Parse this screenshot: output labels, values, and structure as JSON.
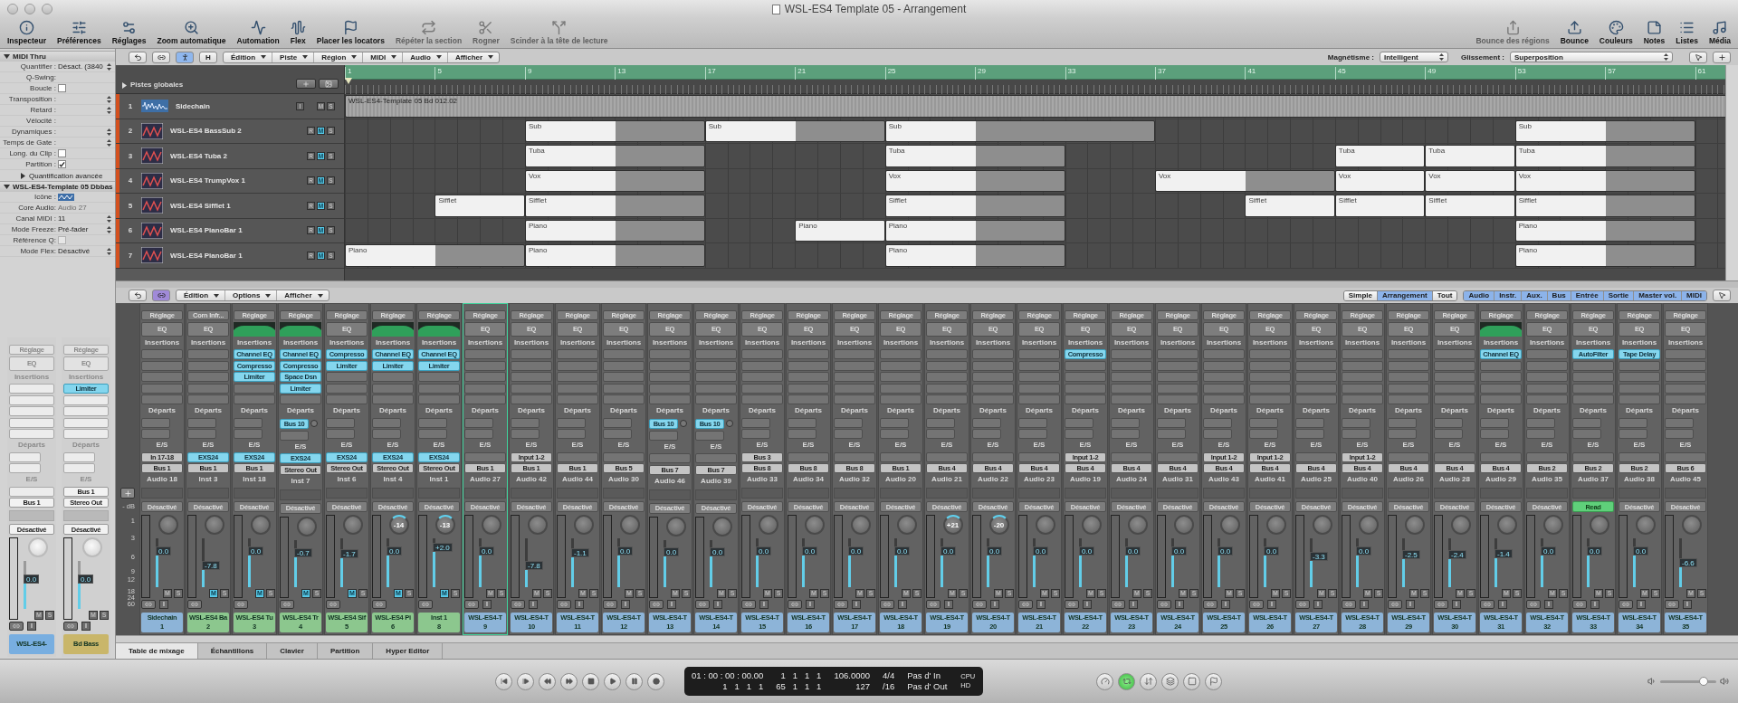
{
  "window": {
    "title": "WSL-ES4 Template 05 - Arrangement"
  },
  "toolbar": {
    "left": [
      {
        "label": "Inspecteur",
        "disabled": false
      },
      {
        "label": "Préférences",
        "disabled": false
      },
      {
        "label": "Réglages",
        "disabled": false
      },
      {
        "label": "Zoom automatique",
        "disabled": false
      },
      {
        "label": "Automation",
        "disabled": false
      },
      {
        "label": "Flex",
        "disabled": false
      },
      {
        "label": "Placer les locators",
        "disabled": false
      },
      {
        "label": "Répéter la section",
        "disabled": true
      },
      {
        "label": "Rogner",
        "disabled": true
      },
      {
        "label": "Scinder à la tête de lecture",
        "disabled": true
      }
    ],
    "right": [
      {
        "label": "Bounce des régions",
        "disabled": true
      },
      {
        "label": "Bounce",
        "disabled": false
      },
      {
        "label": "Couleurs",
        "disabled": false
      },
      {
        "label": "Notes",
        "disabled": false
      },
      {
        "label": "Listes",
        "disabled": false
      },
      {
        "label": "Média",
        "disabled": false
      }
    ]
  },
  "arrange_toolbar": {
    "tools": [
      {
        "kind": "back",
        "on": false
      },
      {
        "kind": "link",
        "on": false
      },
      {
        "kind": "catch",
        "on": true
      },
      {
        "kind": "text",
        "label": "H",
        "on": false
      }
    ],
    "menus": [
      "Édition",
      "Piste",
      "Région",
      "MIDI",
      "Audio",
      "Afficher"
    ],
    "magnetism_label": "Magnétisme :",
    "magnetism": "Intelligent",
    "drag_label": "Glissement :",
    "drag": "Superposition"
  },
  "inspector": {
    "region_header": {
      "label": "MIDI Thru",
      "expanded": true
    },
    "region_params": [
      {
        "label": "Quantifier :",
        "value": "Désact. (3840",
        "kind": "select"
      },
      {
        "label": "Q-Swing:",
        "kind": "text"
      },
      {
        "label": "Boucle :",
        "kind": "checkbox",
        "checked": false
      },
      {
        "label": "Transposition :",
        "kind": "select"
      },
      {
        "label": "Retard :",
        "kind": "select"
      },
      {
        "label": "Vélocité :",
        "kind": "text"
      },
      {
        "label": "Dynamiques :",
        "kind": "select"
      },
      {
        "label": "Temps de Gate :",
        "kind": "select"
      },
      {
        "label": "Long. du Clip :",
        "kind": "checkbox",
        "checked": false
      },
      {
        "label": "Partition :",
        "kind": "checkbox",
        "checked": true
      }
    ],
    "advanced": {
      "label": "Quantification avancée",
      "expanded": false
    },
    "track_header": {
      "label": "WSL-ES4-Template 05 Dbbas",
      "expanded": true
    },
    "track_params": [
      {
        "label": "Icône :",
        "kind": "icon"
      },
      {
        "label": "Core Audio:",
        "value": "Audio 27",
        "kind": "text",
        "disabled": true
      },
      {
        "label": "Canal MIDI :",
        "value": "11",
        "kind": "select"
      },
      {
        "label": "Mode Freeze:",
        "value": "Pré-fader",
        "kind": "select"
      },
      {
        "label": "Référence Q:",
        "kind": "checkbox",
        "checked": false,
        "disabled": true
      },
      {
        "label": "Mode Flex:",
        "value": "Désactivé",
        "kind": "select"
      }
    ],
    "strips": [
      {
        "setting": "Réglage",
        "eq": "EQ",
        "inserts_label": "Insertions",
        "sends_label": "Départs",
        "io_label": "E/S",
        "output": "Bus 1",
        "automation": "Désactivé",
        "read": false,
        "fader": "0.0",
        "level": 0.62,
        "mute": {
          "label": "M",
          "on": false
        },
        "solo": {
          "label": "S",
          "on": false
        },
        "monitor": "I",
        "name": "WSL-ES4-",
        "color": "#78aee0",
        "selected": false
      },
      {
        "setting": "Réglage",
        "eq": "EQ",
        "inserts_label": "Insertions",
        "inserts": [
          "Limiter"
        ],
        "sends_label": "Départs",
        "io_label": "E/S",
        "input": "Bus 1",
        "output": "Stereo Out",
        "automation": "Désactivé",
        "read": false,
        "fader": "0.0",
        "level": 0.62,
        "mute": {
          "label": "M",
          "on": false
        },
        "solo": {
          "label": "S",
          "on": false
        },
        "monitor": "I",
        "name": "Bd Bass",
        "color": "#c9b66a",
        "selected": false
      }
    ]
  },
  "global_tracks": {
    "label": "Pistes globales",
    "expanded": false
  },
  "ruler": [
    "1",
    "5",
    "9",
    "13",
    "17",
    "21",
    "25",
    "29",
    "33",
    "37",
    "41",
    "45",
    "49",
    "53",
    "57",
    "61"
  ],
  "tracks": [
    {
      "number": "1",
      "name": "Sidechain",
      "kind": "audio",
      "buttons": [
        {
          "label": "I",
          "on": false
        },
        {
          "label": "M",
          "on": false
        },
        {
          "label": "S",
          "on": false
        }
      ],
      "lane": [
        {
          "kind": "region",
          "label": "WSL-ES4-Template 05 Bd 012.02"
        },
        {
          "kind": "more"
        },
        {
          "kind": "more"
        },
        {
          "kind": "more"
        },
        {
          "kind": "more"
        },
        {
          "kind": "more"
        },
        {
          "kind": "more"
        },
        {
          "kind": "more"
        },
        {
          "kind": "more"
        },
        {
          "kind": "more"
        },
        {
          "kind": "more"
        },
        {
          "kind": "more"
        },
        {
          "kind": "more"
        },
        {
          "kind": "more"
        },
        {
          "kind": "more"
        },
        {
          "kind": "more"
        }
      ]
    },
    {
      "number": "2",
      "name": "WSL-ES4 BassSub 2",
      "kind": "instrument",
      "buttons": [
        {
          "label": "R",
          "on": false
        },
        {
          "label": "M",
          "on": true
        },
        {
          "label": "S",
          "on": false
        }
      ],
      "lane": [
        {
          "kind": "gap"
        },
        {
          "kind": "gap"
        },
        {
          "kind": "region",
          "label": "Sub"
        },
        {
          "kind": "more"
        },
        {
          "kind": "region",
          "label": "Sub"
        },
        {
          "kind": "more"
        },
        {
          "kind": "region",
          "label": "Sub"
        },
        {
          "kind": "more"
        },
        {
          "kind": "more"
        },
        {
          "kind": "gap"
        },
        {
          "kind": "gap"
        },
        {
          "kind": "gap"
        },
        {
          "kind": "gap"
        },
        {
          "kind": "region",
          "label": "Sub"
        },
        {
          "kind": "more"
        }
      ]
    },
    {
      "number": "3",
      "name": "WSL-ES4 Tuba 2",
      "kind": "instrument",
      "buttons": [
        {
          "label": "R",
          "on": false
        },
        {
          "label": "M",
          "on": true
        },
        {
          "label": "S",
          "on": false
        }
      ],
      "lane": [
        {
          "kind": "gap"
        },
        {
          "kind": "gap"
        },
        {
          "kind": "region",
          "label": "Tuba"
        },
        {
          "kind": "more"
        },
        {
          "kind": "gap"
        },
        {
          "kind": "gap"
        },
        {
          "kind": "region",
          "label": "Tuba"
        },
        {
          "kind": "more"
        },
        {
          "kind": "gap"
        },
        {
          "kind": "gap"
        },
        {
          "kind": "gap"
        },
        {
          "kind": "region",
          "label": "Tuba"
        },
        {
          "kind": "region",
          "label": "Tuba"
        },
        {
          "kind": "region",
          "label": "Tuba"
        },
        {
          "kind": "more"
        }
      ]
    },
    {
      "number": "4",
      "name": "WSL-ES4 TrumpVox 1",
      "kind": "instrument",
      "buttons": [
        {
          "label": "R",
          "on": false
        },
        {
          "label": "M",
          "on": true
        },
        {
          "label": "S",
          "on": false
        }
      ],
      "lane": [
        {
          "kind": "gap"
        },
        {
          "kind": "gap"
        },
        {
          "kind": "region",
          "label": "Vox"
        },
        {
          "kind": "more"
        },
        {
          "kind": "gap"
        },
        {
          "kind": "gap"
        },
        {
          "kind": "region",
          "label": "Vox"
        },
        {
          "kind": "more"
        },
        {
          "kind": "gap"
        },
        {
          "kind": "region",
          "label": "Vox"
        },
        {
          "kind": "more"
        },
        {
          "kind": "region",
          "label": "Vox"
        },
        {
          "kind": "region",
          "label": "Vox"
        },
        {
          "kind": "region",
          "label": "Vox"
        },
        {
          "kind": "more"
        }
      ]
    },
    {
      "number": "5",
      "name": "WSL-ES4 Sifflet 1",
      "kind": "instrument",
      "buttons": [
        {
          "label": "R",
          "on": false
        },
        {
          "label": "M",
          "on": true
        },
        {
          "label": "S",
          "on": false
        }
      ],
      "lane": [
        {
          "kind": "gap"
        },
        {
          "kind": "region",
          "label": "Sifflet"
        },
        {
          "kind": "region",
          "label": "Sifflet"
        },
        {
          "kind": "more"
        },
        {
          "kind": "gap"
        },
        {
          "kind": "gap"
        },
        {
          "kind": "region",
          "label": "Sifflet"
        },
        {
          "kind": "more"
        },
        {
          "kind": "gap"
        },
        {
          "kind": "gap"
        },
        {
          "kind": "region",
          "label": "Sifflet"
        },
        {
          "kind": "region",
          "label": "Sifflet"
        },
        {
          "kind": "region",
          "label": "Sifflet"
        },
        {
          "kind": "region",
          "label": "Sifflet"
        },
        {
          "kind": "more"
        }
      ]
    },
    {
      "number": "6",
      "name": "WSL-ES4 PianoBar 1",
      "kind": "instrument",
      "buttons": [
        {
          "label": "R",
          "on": false
        },
        {
          "label": "M",
          "on": true
        },
        {
          "label": "S",
          "on": false
        }
      ],
      "lane": [
        {
          "kind": "gap"
        },
        {
          "kind": "gap"
        },
        {
          "kind": "region",
          "label": "Piano"
        },
        {
          "kind": "more"
        },
        {
          "kind": "gap"
        },
        {
          "kind": "region",
          "label": "Piano"
        },
        {
          "kind": "region",
          "label": "Piano"
        },
        {
          "kind": "more"
        },
        {
          "kind": "gap"
        },
        {
          "kind": "gap"
        },
        {
          "kind": "gap"
        },
        {
          "kind": "gap"
        },
        {
          "kind": "gap"
        },
        {
          "kind": "region",
          "label": "Piano"
        },
        {
          "kind": "more"
        }
      ]
    },
    {
      "number": "7",
      "name": "WSL-ES4 PianoBar 1",
      "kind": "instrument",
      "buttons": [
        {
          "label": "R",
          "on": false
        },
        {
          "label": "M",
          "on": true
        },
        {
          "label": "S",
          "on": false
        }
      ],
      "lane": [
        {
          "kind": "region",
          "label": "Piano"
        },
        {
          "kind": "more"
        },
        {
          "kind": "region",
          "label": "Piano"
        },
        {
          "kind": "more"
        },
        {
          "kind": "gap"
        },
        {
          "kind": "gap"
        },
        {
          "kind": "region",
          "label": "Piano"
        },
        {
          "kind": "more"
        },
        {
          "kind": "gap"
        },
        {
          "kind": "gap"
        },
        {
          "kind": "gap"
        },
        {
          "kind": "gap"
        },
        {
          "kind": "gap"
        },
        {
          "kind": "region",
          "label": "Piano"
        },
        {
          "kind": "more"
        }
      ]
    }
  ],
  "mixer_toolbar": {
    "tools": [
      {
        "kind": "back",
        "on": false
      },
      {
        "kind": "link",
        "on": true
      }
    ],
    "menus": [
      "Édition",
      "Options",
      "Afficher"
    ],
    "views": [
      {
        "label": "Simple",
        "selected": false
      },
      {
        "label": "Arrangement",
        "selected": true
      },
      {
        "label": "Tout",
        "selected": false
      }
    ],
    "filters": [
      {
        "label": "Audio",
        "selected": true
      },
      {
        "label": "Instr.",
        "selected": true
      },
      {
        "label": "Aux.",
        "selected": true
      },
      {
        "label": "Bus",
        "selected": true
      },
      {
        "label": "Entrée",
        "selected": true
      },
      {
        "label": "Sortie",
        "selected": true
      },
      {
        "label": "Master vol.",
        "selected": true
      },
      {
        "label": "MIDI",
        "selected": true
      }
    ]
  },
  "db_scale": [
    "- dB",
    "1",
    "3",
    "6",
    "9",
    "12",
    "18",
    "24",
    "60"
  ],
  "strips": [
    {
      "setting": "Réglage",
      "eq": "EQ",
      "inserts_label": "Insertions",
      "sends_label": "Départs",
      "io_label": "E/S",
      "input": "In 17-18",
      "output": "Bus 1",
      "track": "Audio 18",
      "automation": "Désactivé",
      "read": false,
      "fader": "0.0",
      "level": 0.75,
      "mute": {
        "label": "M",
        "on": false
      },
      "solo": {
        "label": "S",
        "on": false
      },
      "monitor": "I",
      "name": "Sidechain",
      "number": "1",
      "color": "#8db4d8",
      "selected": false
    },
    {
      "setting": "Corn Infr...",
      "eq": "EQ",
      "inserts_label": "Insertions",
      "sends_label": "Départs",
      "io_label": "E/S",
      "input": "EXS24",
      "input_plugin": true,
      "output": "Bus 1",
      "track": "Inst 3",
      "automation": "Désactivé",
      "read": false,
      "fader": "-7.8",
      "level": 0.45,
      "mute": {
        "label": "M",
        "on": true
      },
      "solo": {
        "label": "S",
        "on": false
      },
      "name": "WSL-ES4 Ba",
      "number": "2",
      "color": "#8cc78e",
      "selected": false
    },
    {
      "setting": "Réglage",
      "eq_curve": true,
      "inserts_label": "Insertions",
      "inserts": [
        "Channel EQ",
        "Compresso",
        "Limiter"
      ],
      "sends_label": "Départs",
      "io_label": "E/S",
      "input": "EXS24",
      "input_plugin": true,
      "output": "Bus 1",
      "track": "Inst 18",
      "automation": "Désactivé",
      "read": false,
      "fader": "0.0",
      "level": 0.75,
      "mute": {
        "label": "M",
        "on": true
      },
      "solo": {
        "label": "S",
        "on": false
      },
      "name": "WSL-ES4 Tu",
      "number": "3",
      "color": "#8cc78e",
      "selected": false
    },
    {
      "setting": "Réglage",
      "eq_curve": true,
      "inserts_label": "Insertions",
      "inserts": [
        "Channel EQ",
        "Compresso",
        "Space Dsn",
        "Limiter"
      ],
      "sends_label": "Départs",
      "sends": [
        "Bus 10"
      ],
      "io_label": "E/S",
      "input": "EXS24",
      "input_plugin": true,
      "output": "Stereo Out",
      "track": "Inst 7",
      "automation": "Désactivé",
      "read": false,
      "fader": "-0.7",
      "level": 0.72,
      "mute": {
        "label": "M",
        "on": true
      },
      "solo": {
        "label": "S",
        "on": false
      },
      "name": "WSL-ES4 Tr",
      "number": "4",
      "color": "#8cc78e",
      "selected": false
    },
    {
      "setting": "Réglage",
      "eq": "EQ",
      "inserts_label": "Insertions",
      "inserts": [
        "Compresso",
        "Limiter"
      ],
      "sends_label": "Départs",
      "io_label": "E/S",
      "input": "EXS24",
      "input_plugin": true,
      "output": "Stereo Out",
      "track": "Inst 6",
      "automation": "Désactivé",
      "read": false,
      "fader": "-1.7",
      "level": 0.68,
      "mute": {
        "label": "M",
        "on": true
      },
      "solo": {
        "label": "S",
        "on": false
      },
      "name": "WSL-ES4 Sif",
      "number": "5",
      "color": "#8cc78e",
      "selected": false
    },
    {
      "setting": "Réglage",
      "eq_curve": true,
      "inserts_label": "Insertions",
      "inserts": [
        "Channel EQ",
        "Limiter"
      ],
      "sends_label": "Départs",
      "io_label": "E/S",
      "input": "EXS24",
      "input_plugin": true,
      "output": "Stereo Out",
      "track": "Inst 4",
      "automation": "Désactivé",
      "read": false,
      "pan": "-14",
      "fader": "0.0",
      "level": 0.75,
      "mute": {
        "label": "M",
        "on": true
      },
      "solo": {
        "label": "S",
        "on": false
      },
      "name": "WSL-ES4 Pi",
      "number": "6",
      "color": "#8cc78e",
      "selected": false
    },
    {
      "setting": "Réglage",
      "eq_curve": true,
      "inserts_label": "Insertions",
      "inserts": [
        "Channel EQ",
        "Limiter"
      ],
      "sends_label": "Départs",
      "io_label": "E/S",
      "input": "EXS24",
      "input_plugin": true,
      "output": "Stereo Out",
      "track": "Inst 1",
      "automation": "Désactivé",
      "read": false,
      "pan": "-13",
      "fader": "+2.0",
      "level": 0.82,
      "mute": {
        "label": "M",
        "on": true
      },
      "solo": {
        "label": "S",
        "on": false
      },
      "name": "Inst 1",
      "number": "8",
      "color": "#8cc78e",
      "selected": false
    },
    {
      "setting": "Réglage",
      "eq": "EQ",
      "inserts_label": "Insertions",
      "sends_label": "Départs",
      "io_label": "E/S",
      "output": "Bus 1",
      "track": "Audio 27",
      "automation": "Désactivé",
      "read": false,
      "fader": "0.0",
      "level": 0.75,
      "mute": {
        "label": "M",
        "on": false
      },
      "solo": {
        "label": "S",
        "on": false
      },
      "monitor": "I",
      "name": "WSL-ES4-T",
      "number": "9",
      "color": "#8db4d8",
      "selected": true
    },
    {
      "setting": "Réglage",
      "eq": "EQ",
      "inserts_label": "Insertions",
      "sends_label": "Départs",
      "io_label": "E/S",
      "input": "Input 1-2",
      "output": "Bus 1",
      "track": "Audio 42",
      "automation": "Désactivé",
      "read": false,
      "fader": "-7.8",
      "level": 0.45,
      "mute": {
        "label": "M",
        "on": false
      },
      "solo": {
        "label": "S",
        "on": false
      },
      "monitor": "I",
      "name": "WSL-ES4-T",
      "number": "10",
      "color": "#8db4d8",
      "selected": false
    },
    {
      "setting": "Réglage",
      "eq": "EQ",
      "inserts_label": "Insertions",
      "sends_label": "Départs",
      "io_label": "E/S",
      "output": "Bus 1",
      "track": "Audio 44",
      "automation": "Désactivé",
      "read": false,
      "fader": "-1.1",
      "level": 0.7,
      "mute": {
        "label": "M",
        "on": false
      },
      "solo": {
        "label": "S",
        "on": false
      },
      "monitor": "I",
      "name": "WSL-ES4-T",
      "number": "11",
      "color": "#8db4d8",
      "selected": false
    },
    {
      "setting": "Réglage",
      "eq": "EQ",
      "inserts_label": "Insertions",
      "sends_label": "Départs",
      "io_label": "E/S",
      "output": "Bus 5",
      "track": "Audio 30",
      "automation": "Désactivé",
      "read": false,
      "fader": "0.0",
      "level": 0.75,
      "mute": {
        "label": "M",
        "on": false
      },
      "solo": {
        "label": "S",
        "on": false
      },
      "monitor": "I",
      "name": "WSL-ES4-T",
      "number": "12",
      "color": "#8db4d8",
      "selected": false
    },
    {
      "setting": "Réglage",
      "eq": "EQ",
      "inserts_label": "Insertions",
      "sends_label": "Départs",
      "sends": [
        "Bus 10"
      ],
      "io_label": "E/S",
      "output": "Bus 7",
      "track": "Audio 46",
      "automation": "Désactivé",
      "read": false,
      "fader": "0.0",
      "level": 0.75,
      "mute": {
        "label": "M",
        "on": false
      },
      "solo": {
        "label": "S",
        "on": false
      },
      "monitor": "I",
      "name": "WSL-ES4-T",
      "number": "13",
      "color": "#8db4d8",
      "selected": false
    },
    {
      "setting": "Réglage",
      "eq": "EQ",
      "inserts_label": "Insertions",
      "sends_label": "Départs",
      "sends": [
        "Bus 10"
      ],
      "io_label": "E/S",
      "output": "Bus 7",
      "track": "Audio 39",
      "automation": "Désactivé",
      "read": false,
      "fader": "0.0",
      "level": 0.75,
      "mute": {
        "label": "M",
        "on": false
      },
      "solo": {
        "label": "S",
        "on": false
      },
      "monitor": "I",
      "name": "WSL-ES4-T",
      "number": "14",
      "color": "#8db4d8",
      "selected": false
    },
    {
      "setting": "Réglage",
      "eq": "EQ",
      "inserts_label": "Insertions",
      "sends_label": "Départs",
      "io_label": "E/S",
      "input": "Bus 3",
      "output": "Bus 8",
      "track": "Audio 33",
      "automation": "Désactivé",
      "read": false,
      "fader": "0.0",
      "level": 0.75,
      "mute": {
        "label": "M",
        "on": false
      },
      "solo": {
        "label": "S",
        "on": false
      },
      "monitor": "I",
      "name": "WSL-ES4-T",
      "number": "15",
      "color": "#8db4d8",
      "selected": false
    },
    {
      "setting": "Réglage",
      "eq": "EQ",
      "inserts_label": "Insertions",
      "sends_label": "Départs",
      "io_label": "E/S",
      "output": "Bus 8",
      "track": "Audio 34",
      "automation": "Désactivé",
      "read": false,
      "fader": "0.0",
      "level": 0.75,
      "mute": {
        "label": "M",
        "on": false
      },
      "solo": {
        "label": "S",
        "on": false
      },
      "monitor": "I",
      "name": "WSL-ES4-T",
      "number": "16",
      "color": "#8db4d8",
      "selected": false
    },
    {
      "setting": "Réglage",
      "eq": "EQ",
      "inserts_label": "Insertions",
      "sends_label": "Départs",
      "io_label": "E/S",
      "output": "Bus 8",
      "track": "Audio 32",
      "automation": "Désactivé",
      "read": false,
      "fader": "0.0",
      "level": 0.75,
      "mute": {
        "label": "M",
        "on": false
      },
      "solo": {
        "label": "S",
        "on": false
      },
      "monitor": "I",
      "name": "WSL-ES4-T",
      "number": "17",
      "color": "#8db4d8",
      "selected": false
    },
    {
      "setting": "Réglage",
      "eq": "EQ",
      "inserts_label": "Insertions",
      "sends_label": "Départs",
      "io_label": "E/S",
      "output": "Bus 1",
      "track": "Audio 20",
      "automation": "Désactivé",
      "read": false,
      "fader": "0.0",
      "level": 0.75,
      "mute": {
        "label": "M",
        "on": false
      },
      "solo": {
        "label": "S",
        "on": false
      },
      "monitor": "I",
      "name": "WSL-ES4-T",
      "number": "18",
      "color": "#8db4d8",
      "selected": false
    },
    {
      "setting": "Réglage",
      "eq": "EQ",
      "inserts_label": "Insertions",
      "sends_label": "Départs",
      "io_label": "E/S",
      "output": "Bus 4",
      "track": "Audio 21",
      "automation": "Désactivé",
      "read": false,
      "pan": "+21",
      "fader": "0.0",
      "level": 0.75,
      "mute": {
        "label": "M",
        "on": false
      },
      "solo": {
        "label": "S",
        "on": false
      },
      "monitor": "I",
      "name": "WSL-ES4-T",
      "number": "19",
      "color": "#8db4d8",
      "selected": false
    },
    {
      "setting": "Réglage",
      "eq": "EQ",
      "inserts_label": "Insertions",
      "sends_label": "Départs",
      "io_label": "E/S",
      "output": "Bus 4",
      "track": "Audio 22",
      "automation": "Désactivé",
      "read": false,
      "pan": "-20",
      "fader": "0.0",
      "level": 0.75,
      "mute": {
        "label": "M",
        "on": false
      },
      "solo": {
        "label": "S",
        "on": false
      },
      "monitor": "I",
      "name": "WSL-ES4-T",
      "number": "20",
      "color": "#8db4d8",
      "selected": false
    },
    {
      "setting": "Réglage",
      "eq": "EQ",
      "inserts_label": "Insertions",
      "sends_label": "Départs",
      "io_label": "E/S",
      "output": "Bus 4",
      "track": "Audio 23",
      "automation": "Désactivé",
      "read": false,
      "fader": "0.0",
      "level": 0.75,
      "mute": {
        "label": "M",
        "on": false
      },
      "solo": {
        "label": "S",
        "on": false
      },
      "monitor": "I",
      "name": "WSL-ES4-T",
      "number": "21",
      "color": "#8db4d8",
      "selected": false
    },
    {
      "setting": "Réglage",
      "eq": "EQ",
      "inserts_label": "Insertions",
      "inserts": [
        "Compresso"
      ],
      "sends_label": "Départs",
      "io_label": "E/S",
      "input": "Input 1-2",
      "output": "Bus 4",
      "track": "Audio 19",
      "automation": "Désactivé",
      "read": false,
      "fader": "0.0",
      "level": 0.75,
      "mute": {
        "label": "M",
        "on": false
      },
      "solo": {
        "label": "S",
        "on": false
      },
      "monitor": "I",
      "name": "WSL-ES4-T",
      "number": "22",
      "color": "#8db4d8",
      "selected": false
    },
    {
      "setting": "Réglage",
      "eq": "EQ",
      "inserts_label": "Insertions",
      "sends_label": "Départs",
      "io_label": "E/S",
      "output": "Bus 4",
      "track": "Audio 24",
      "automation": "Désactivé",
      "read": false,
      "fader": "0.0",
      "level": 0.75,
      "mute": {
        "label": "M",
        "on": false
      },
      "solo": {
        "label": "S",
        "on": false
      },
      "monitor": "I",
      "name": "WSL-ES4-T",
      "number": "23",
      "color": "#8db4d8",
      "selected": false
    },
    {
      "setting": "Réglage",
      "eq": "EQ",
      "inserts_label": "Insertions",
      "sends_label": "Départs",
      "io_label": "E/S",
      "output": "Bus 4",
      "track": "Audio 31",
      "automation": "Désactivé",
      "read": false,
      "fader": "0.0",
      "level": 0.75,
      "mute": {
        "label": "M",
        "on": false
      },
      "solo": {
        "label": "S",
        "on": false
      },
      "monitor": "I",
      "name": "WSL-ES4-T",
      "number": "24",
      "color": "#8db4d8",
      "selected": false
    },
    {
      "setting": "Réglage",
      "eq": "EQ",
      "inserts_label": "Insertions",
      "sends_label": "Départs",
      "io_label": "E/S",
      "input": "Input 1-2",
      "output": "Bus 4",
      "track": "Audio 43",
      "automation": "Désactivé",
      "read": false,
      "fader": "0.0",
      "level": 0.75,
      "mute": {
        "label": "M",
        "on": false
      },
      "solo": {
        "label": "S",
        "on": false
      },
      "monitor": "I",
      "name": "WSL-ES4-T",
      "number": "25",
      "color": "#8db4d8",
      "selected": false
    },
    {
      "setting": "Réglage",
      "eq": "EQ",
      "inserts_label": "Insertions",
      "sends_label": "Départs",
      "io_label": "E/S",
      "input": "Input 1-2",
      "output": "Bus 4",
      "track": "Audio 41",
      "automation": "Désactivé",
      "read": false,
      "fader": "0.0",
      "level": 0.75,
      "mute": {
        "label": "M",
        "on": false
      },
      "solo": {
        "label": "S",
        "on": false
      },
      "monitor": "I",
      "name": "WSL-ES4-T",
      "number": "26",
      "color": "#8db4d8",
      "selected": false
    },
    {
      "setting": "Réglage",
      "eq": "EQ",
      "inserts_label": "Insertions",
      "sends_label": "Départs",
      "io_label": "E/S",
      "output": "Bus 4",
      "track": "Audio 25",
      "automation": "Désactivé",
      "read": false,
      "fader": "-3.3",
      "level": 0.63,
      "mute": {
        "label": "M",
        "on": false
      },
      "solo": {
        "label": "S",
        "on": false
      },
      "monitor": "I",
      "name": "WSL-ES4-T",
      "number": "27",
      "color": "#8db4d8",
      "selected": false
    },
    {
      "setting": "Réglage",
      "eq": "EQ",
      "inserts_label": "Insertions",
      "sends_label": "Départs",
      "io_label": "E/S",
      "input": "Input 1-2",
      "output": "Bus 4",
      "track": "Audio 40",
      "automation": "Désactivé",
      "read": false,
      "fader": "0.0",
      "level": 0.75,
      "mute": {
        "label": "M",
        "on": false
      },
      "solo": {
        "label": "S",
        "on": false
      },
      "monitor": "I",
      "name": "WSL-ES4-T",
      "number": "28",
      "color": "#8db4d8",
      "selected": false
    },
    {
      "setting": "Réglage",
      "eq": "EQ",
      "inserts_label": "Insertions",
      "sends_label": "Départs",
      "io_label": "E/S",
      "output": "Bus 4",
      "track": "Audio 26",
      "automation": "Désactivé",
      "read": false,
      "fader": "-2.5",
      "level": 0.66,
      "mute": {
        "label": "M",
        "on": false
      },
      "solo": {
        "label": "S",
        "on": false
      },
      "monitor": "I",
      "name": "WSL-ES4-T",
      "number": "29",
      "color": "#8db4d8",
      "selected": false
    },
    {
      "setting": "Réglage",
      "eq": "EQ",
      "inserts_label": "Insertions",
      "sends_label": "Départs",
      "io_label": "E/S",
      "output": "Bus 4",
      "track": "Audio 28",
      "automation": "Désactivé",
      "read": false,
      "fader": "-2.4",
      "level": 0.66,
      "mute": {
        "label": "M",
        "on": false
      },
      "solo": {
        "label": "S",
        "on": false
      },
      "monitor": "I",
      "name": "WSL-ES4-T",
      "number": "30",
      "color": "#8db4d8",
      "selected": false
    },
    {
      "setting": "Réglage",
      "eq_curve": true,
      "inserts_label": "Insertions",
      "inserts": [
        "Channel EQ"
      ],
      "sends_label": "Départs",
      "io_label": "E/S",
      "output": "Bus 4",
      "track": "Audio 29",
      "automation": "Désactivé",
      "read": false,
      "fader": "-1.4",
      "level": 0.69,
      "mute": {
        "label": "M",
        "on": false
      },
      "solo": {
        "label": "S",
        "on": false
      },
      "monitor": "I",
      "name": "WSL-ES4-T",
      "number": "31",
      "color": "#8db4d8",
      "selected": false
    },
    {
      "setting": "Réglage",
      "eq": "EQ",
      "inserts_label": "Insertions",
      "sends_label": "Départs",
      "io_label": "E/S",
      "output": "Bus 2",
      "track": "Audio 35",
      "automation": "Désactivé",
      "read": false,
      "fader": "0.0",
      "level": 0.75,
      "mute": {
        "label": "M",
        "on": false
      },
      "solo": {
        "label": "S",
        "on": false
      },
      "monitor": "I",
      "name": "WSL-ES4-T",
      "number": "32",
      "color": "#8db4d8",
      "selected": false
    },
    {
      "setting": "Réglage",
      "eq": "EQ",
      "inserts_label": "Insertions",
      "inserts": [
        "AutoFilter"
      ],
      "sends_label": "Départs",
      "io_label": "E/S",
      "output": "Bus 2",
      "track": "Audio 37",
      "automation": "Read",
      "read": true,
      "fader": "0.0",
      "level": 0.75,
      "mute": {
        "label": "M",
        "on": false
      },
      "solo": {
        "label": "S",
        "on": false
      },
      "monitor": "I",
      "name": "WSL-ES4-T",
      "number": "33",
      "color": "#8db4d8",
      "selected": false
    },
    {
      "setting": "Réglage",
      "eq": "EQ",
      "inserts_label": "Insertions",
      "inserts": [
        "Tape Delay"
      ],
      "sends_label": "Départs",
      "io_label": "E/S",
      "output": "Bus 2",
      "track": "Audio 38",
      "automation": "Désactivé",
      "read": false,
      "fader": "0.0",
      "level": 0.75,
      "mute": {
        "label": "M",
        "on": false
      },
      "solo": {
        "label": "S",
        "on": false
      },
      "monitor": "I",
      "name": "WSL-ES4-T",
      "number": "34",
      "color": "#8db4d8",
      "selected": false
    },
    {
      "setting": "Réglage",
      "eq": "EQ",
      "inserts_label": "Insertions",
      "sends_label": "Départs",
      "io_label": "E/S",
      "output": "Bus 6",
      "track": "Audio 45",
      "automation": "Désactivé",
      "read": false,
      "fader": "-6.6",
      "level": 0.5,
      "mute": {
        "label": "M",
        "on": false
      },
      "solo": {
        "label": "S",
        "on": false
      },
      "monitor": "I",
      "name": "WSL-ES4-T",
      "number": "35",
      "color": "#8db4d8",
      "selected": false
    }
  ],
  "bottom_tabs": [
    {
      "label": "Table de mixage",
      "selected": true
    },
    {
      "label": "Échantillons",
      "selected": false
    },
    {
      "label": "Clavier",
      "selected": false
    },
    {
      "label": "Partition",
      "selected": false
    },
    {
      "label": "Hyper Editor",
      "selected": false
    }
  ],
  "transport": {
    "display": [
      [
        "01 : 00 : 00 : 00.00",
        "1   1   1   1",
        "106.0000",
        "4/4",
        "Pas d' In"
      ],
      [
        "1   1   1   1",
        "65   1   1   1",
        "127",
        "/16",
        "Pas d' Out"
      ]
    ],
    "meters": [
      "CPU",
      "HD"
    ],
    "modes": [
      {
        "kind": "gauge",
        "on": false
      },
      {
        "kind": "cycle",
        "on": true
      },
      {
        "kind": "replace",
        "on": false
      },
      {
        "kind": "solo",
        "on": false
      },
      {
        "kind": "sync",
        "on": false
      },
      {
        "kind": "metronome",
        "on": false
      }
    ],
    "volume": {
      "level": 0.78
    }
  }
}
